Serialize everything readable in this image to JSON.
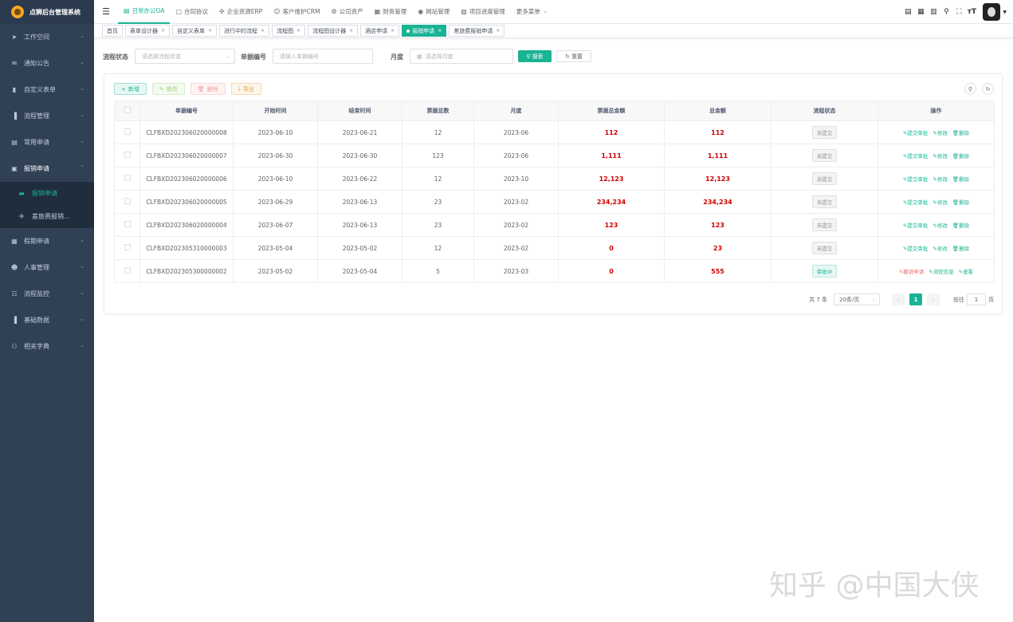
{
  "app": {
    "title": "点狮后台管理系统"
  },
  "sidebar": {
    "items": [
      {
        "label": "工作空间",
        "icon": "send-icon"
      },
      {
        "label": "通知公告",
        "icon": "mail-icon"
      },
      {
        "label": "自定义表单",
        "icon": "form-icon"
      },
      {
        "label": "流程管理",
        "icon": "chart-icon"
      },
      {
        "label": "常用申请",
        "icon": "doc-icon"
      },
      {
        "label": "报销申请",
        "icon": "wallet-icon",
        "open": true
      },
      {
        "label": "假期申请",
        "icon": "calendar-icon"
      },
      {
        "label": "人事管理",
        "icon": "people-icon"
      },
      {
        "label": "流程监控",
        "icon": "monitor-icon"
      },
      {
        "label": "基础数据",
        "icon": "bar-icon"
      },
      {
        "label": "相关字典",
        "icon": "dict-icon"
      }
    ],
    "sub_items": [
      {
        "label": "报销申请",
        "active": true
      },
      {
        "label": "差旅费报销..."
      }
    ]
  },
  "topnav": {
    "items": [
      {
        "label": "日常办公OA",
        "active": true
      },
      {
        "label": "合同协议"
      },
      {
        "label": "企业资源ERP"
      },
      {
        "label": "客户维护CRM"
      },
      {
        "label": "公司资产"
      },
      {
        "label": "财务管理"
      },
      {
        "label": "网站管理"
      },
      {
        "label": "项目进度管理"
      },
      {
        "label": "更多菜单"
      }
    ]
  },
  "tabs": [
    {
      "label": "首页"
    },
    {
      "label": "表单设计器"
    },
    {
      "label": "自定义表单"
    },
    {
      "label": "进行中的流程"
    },
    {
      "label": "流程图"
    },
    {
      "label": "流程图设计器"
    },
    {
      "label": "酒店申请"
    },
    {
      "label": "报销申请",
      "active": true
    },
    {
      "label": "差旅费报销申请"
    }
  ],
  "search": {
    "status_label": "流程状态",
    "status_placeholder": "请选择流程状态",
    "code_label": "单据编号",
    "code_placeholder": "请输入单据编号",
    "month_label": "月度",
    "month_placeholder": "请选择月度",
    "search_btn": "搜索",
    "reset_btn": "重置"
  },
  "toolbar": {
    "add": "新增",
    "edit": "修改",
    "delete": "删除",
    "export": "导出"
  },
  "table": {
    "columns": [
      "单据编号",
      "开始时间",
      "结束时间",
      "票据总数",
      "月度",
      "票据总金额",
      "总金额",
      "流程状态",
      "操作"
    ],
    "rows": [
      {
        "code": "CLFBXD202306020000008",
        "start": "2023-06-10",
        "end": "2023-06-21",
        "count": "12",
        "month": "2023-06",
        "ticket_amount": "112",
        "total": "112",
        "status": "未提交",
        "ops": [
          "提交审批",
          "修改",
          "删除"
        ]
      },
      {
        "code": "CLFBXD202306020000007",
        "start": "2023-06-30",
        "end": "2023-06-30",
        "count": "123",
        "month": "2023-06",
        "ticket_amount": "1,111",
        "total": "1,111",
        "status": "未提交",
        "ops": [
          "提交审批",
          "修改",
          "删除"
        ]
      },
      {
        "code": "CLFBXD202306020000006",
        "start": "2023-06-10",
        "end": "2023-06-22",
        "count": "12",
        "month": "2023-10",
        "ticket_amount": "12,123",
        "total": "12,123",
        "status": "未提交",
        "ops": [
          "提交审批",
          "修改",
          "删除"
        ]
      },
      {
        "code": "CLFBXD202306020000005",
        "start": "2023-06-29",
        "end": "2023-06-13",
        "count": "23",
        "month": "2023-02",
        "ticket_amount": "234,234",
        "total": "234,234",
        "status": "未提交",
        "ops": [
          "提交审批",
          "修改",
          "删除"
        ]
      },
      {
        "code": "CLFBXD202306020000004",
        "start": "2023-06-07",
        "end": "2023-06-13",
        "count": "23",
        "month": "2023-02",
        "ticket_amount": "123",
        "total": "123",
        "status": "未提交",
        "ops": [
          "提交审批",
          "修改",
          "删除"
        ]
      },
      {
        "code": "CLFBXD202305310000003",
        "start": "2023-05-04",
        "end": "2023-05-02",
        "count": "12",
        "month": "2023-02",
        "ticket_amount": "0",
        "total": "23",
        "status": "未提交",
        "ops": [
          "提交审批",
          "修改",
          "删除"
        ]
      },
      {
        "code": "CLFBXD202305300000002",
        "start": "2023-05-02",
        "end": "2023-05-04",
        "count": "5",
        "month": "2023-03",
        "ticket_amount": "0",
        "total": "555",
        "status": "审批中",
        "status_type": "approving",
        "ops": [
          "撤销申请",
          "流程信息",
          "查看"
        ]
      }
    ]
  },
  "pagination": {
    "total_text": "共 7 条",
    "page_size": "20条/页",
    "current_page": "1",
    "goto_label": "前往",
    "goto_value": "1",
    "page_unit": "页"
  },
  "watermark": "知乎 @中国大侠"
}
